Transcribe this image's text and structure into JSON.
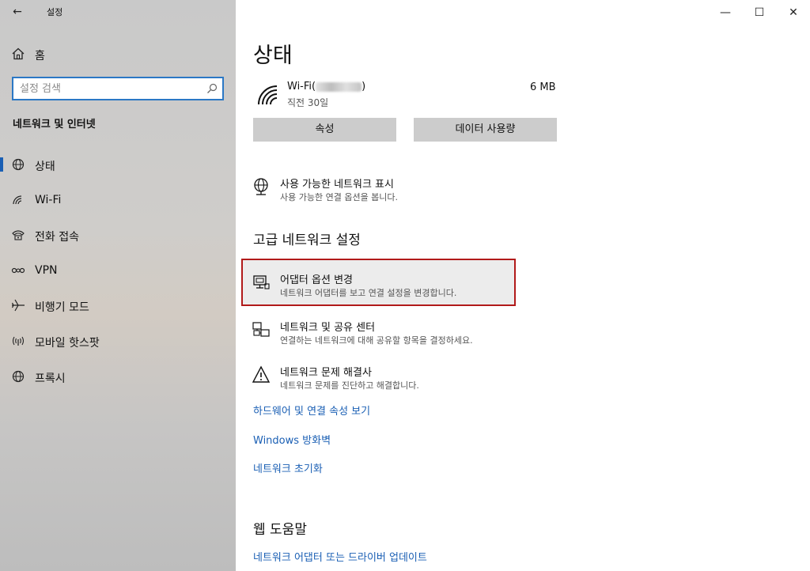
{
  "app": {
    "title": "설정",
    "back_icon": "back-arrow-icon"
  },
  "window_controls": {
    "minimize": "—",
    "maximize": "☐",
    "close": "✕"
  },
  "sidebar": {
    "home_label": "홈",
    "search_placeholder": "설정 검색",
    "section_title": "네트워크 및 인터넷",
    "items": [
      {
        "label": "상태",
        "icon": "globe-status-icon",
        "active": true
      },
      {
        "label": "Wi-Fi",
        "icon": "wifi-icon",
        "active": false
      },
      {
        "label": "전화 접속",
        "icon": "dialup-icon",
        "active": false
      },
      {
        "label": "VPN",
        "icon": "vpn-icon",
        "active": false
      },
      {
        "label": "비행기 모드",
        "icon": "airplane-icon",
        "active": false
      },
      {
        "label": "모바일 핫스팟",
        "icon": "hotspot-icon",
        "active": false
      },
      {
        "label": "프록시",
        "icon": "proxy-globe-icon",
        "active": false
      }
    ]
  },
  "main": {
    "title": "상태",
    "connection": {
      "name_prefix": "Wi-Fi(",
      "name_suffix": ")",
      "sub": "직전 30일",
      "usage": "6 MB"
    },
    "buttons": {
      "properties": "속성",
      "data_usage": "데이터 사용량"
    },
    "show_networks": {
      "title": "사용 가능한 네트워크 표시",
      "desc": "사용 가능한 연결 옵션을 봅니다."
    },
    "advanced_heading": "고급 네트워크 설정",
    "adapter_options": {
      "title": "어댑터 옵션 변경",
      "desc": "네트워크 어댑터를 보고 연결 설정을 변경합니다."
    },
    "sharing_center": {
      "title": "네트워크 및 공유 센터",
      "desc": "연결하는 네트워크에 대해 공유할 항목을 결정하세요."
    },
    "troubleshooter": {
      "title": "네트워크 문제 해결사",
      "desc": "네트워크 문제를 진단하고 해결합니다."
    },
    "links": {
      "hardware": "하드웨어 및 연결 속성 보기",
      "firewall": "Windows 방화벽",
      "reset": "네트워크 초기화"
    },
    "help_heading": "웹 도움말",
    "help_link": "네트워크 어댑터 또는 드라이버 업데이트"
  },
  "colors": {
    "accent": "#1a5fb4",
    "highlight_border": "#b11a1a",
    "button_bg": "#cccccc"
  }
}
